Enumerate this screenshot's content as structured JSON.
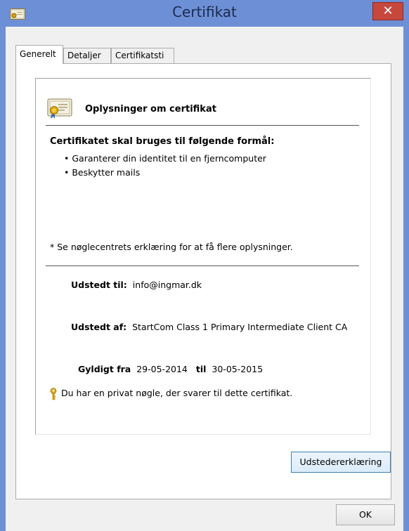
{
  "window": {
    "title": "Certifikat",
    "close_glyph": "✕"
  },
  "tabs": [
    {
      "label": "Generelt",
      "active": true
    },
    {
      "label": "Detaljer",
      "active": false
    },
    {
      "label": "Certifikatsti",
      "active": false
    }
  ],
  "general": {
    "heading": "Oplysninger om certifikat",
    "purpose_title": "Certifikatet skal bruges til følgende formål:",
    "purposes": [
      "Garanterer din identitet til en fjerncomputer",
      "Beskytter mails"
    ],
    "issuer_note": "* Se nøglecentrets erklæring for at få flere oplysninger.",
    "issued_to_label": "Udstedt til:",
    "issued_to_value": "info@ingmar.dk",
    "issued_by_label": "Udstedt af:",
    "issued_by_value": "StartCom Class 1 Primary Intermediate Client CA",
    "valid_from_label": "Gyldigt fra",
    "valid_from_value": "29-05-2014",
    "valid_to_label": "til",
    "valid_to_value": "30-05-2015",
    "private_key_note": "Du har en privat nøgle, der svarer til dette certifikat."
  },
  "buttons": {
    "issuer_statement": "Udstedererklæring",
    "ok": "OK"
  },
  "icons": {
    "window": "certificate-icon",
    "heading": "certificate-icon",
    "key": "key-icon"
  },
  "colors": {
    "frame": "#6d8fd6",
    "close_button": "#c8473d",
    "client_bg": "#f0f0f0"
  }
}
